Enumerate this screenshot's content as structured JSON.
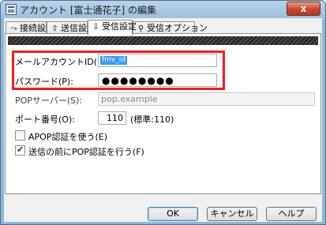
{
  "window": {
    "title": "アカウント [富士通花子] の編集",
    "close_symbol": "x"
  },
  "tabs": [
    {
      "label": "接続設定",
      "icon": "connection-icon",
      "glyph": "⤳",
      "active": false
    },
    {
      "label": "送信設定",
      "icon": "send-icon",
      "glyph": "⇧",
      "active": false
    },
    {
      "label": "受信設定",
      "icon": "receive-icon",
      "glyph": "⇩",
      "active": true
    },
    {
      "label": "受信オプション",
      "icon": "options-icon",
      "glyph": "⚲",
      "active": false
    }
  ],
  "form": {
    "mail_account_id": {
      "label": "メールアカウントID(U):",
      "value": "fmv_id"
    },
    "password": {
      "label": "パスワード(P):",
      "value": "●●●●●●●●"
    },
    "pop_server": {
      "label": "POPサーバー(S):",
      "value": "pop.example"
    },
    "port": {
      "label": "ポート番号(O):",
      "value": "110",
      "note": "(標準:110)"
    },
    "apop": {
      "label": "APOP認証を使う(E)",
      "checked": false
    },
    "pop_before_send": {
      "label": "送信の前にPOP認証を行う(F)",
      "checked": true
    }
  },
  "buttons": {
    "ok": "OK",
    "cancel": "キャンセル",
    "help": "ヘルプ"
  },
  "colors": {
    "highlight": "#ff1a1a",
    "selection": "#3399ff"
  }
}
